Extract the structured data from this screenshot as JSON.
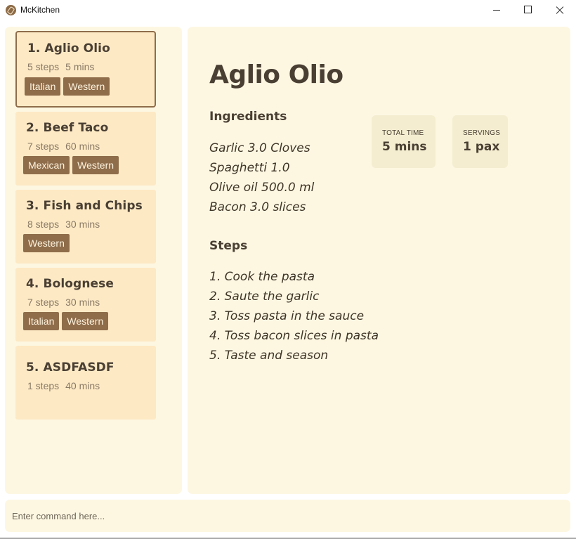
{
  "window": {
    "title": "McKitchen"
  },
  "recipes": [
    {
      "title": "1. Aglio Olio",
      "steps": "5 steps",
      "time": "5 mins",
      "tags": [
        "Italian",
        "Western"
      ],
      "selected": true
    },
    {
      "title": "2. Beef Taco",
      "steps": "7 steps",
      "time": "60 mins",
      "tags": [
        "Mexican",
        "Western"
      ]
    },
    {
      "title": "3. Fish and Chips",
      "steps": "8 steps",
      "time": "30 mins",
      "tags": [
        "Western"
      ]
    },
    {
      "title": "4. Bolognese",
      "steps": "7 steps",
      "time": "30 mins",
      "tags": [
        "Italian",
        "Western"
      ]
    },
    {
      "title": "5. ASDFASDF",
      "steps": "1 steps",
      "time": "40 mins",
      "tags": []
    }
  ],
  "detail": {
    "title": "Aglio Olio",
    "ingredients_heading": "Ingredients",
    "ingredients": [
      "Garlic 3.0 Cloves",
      "Spaghetti 1.0",
      "Olive oil 500.0 ml",
      "Bacon 3.0 slices"
    ],
    "steps_heading": "Steps",
    "steps": [
      "1. Cook the pasta",
      "2. Saute the garlic",
      "3. Toss pasta in the sauce",
      "4. Toss bacon slices in pasta",
      "5. Taste and season"
    ],
    "total_time_label": "TOTAL TIME",
    "total_time_value": "5 mins",
    "servings_label": "SERVINGS",
    "servings_value": "1 pax"
  },
  "command": {
    "placeholder": "Enter command here..."
  },
  "colors": {
    "panel_bg": "#fdf7e2",
    "card_bg": "#fde9c4",
    "tag_bg": "#8f6d4b",
    "text_dark": "#4a3f33",
    "stat_bg": "#f4edd0"
  },
  "icons": {
    "app": "mckitchen-app-icon",
    "minimize": "minimize-icon",
    "maximize": "maximize-icon",
    "close": "close-icon"
  }
}
